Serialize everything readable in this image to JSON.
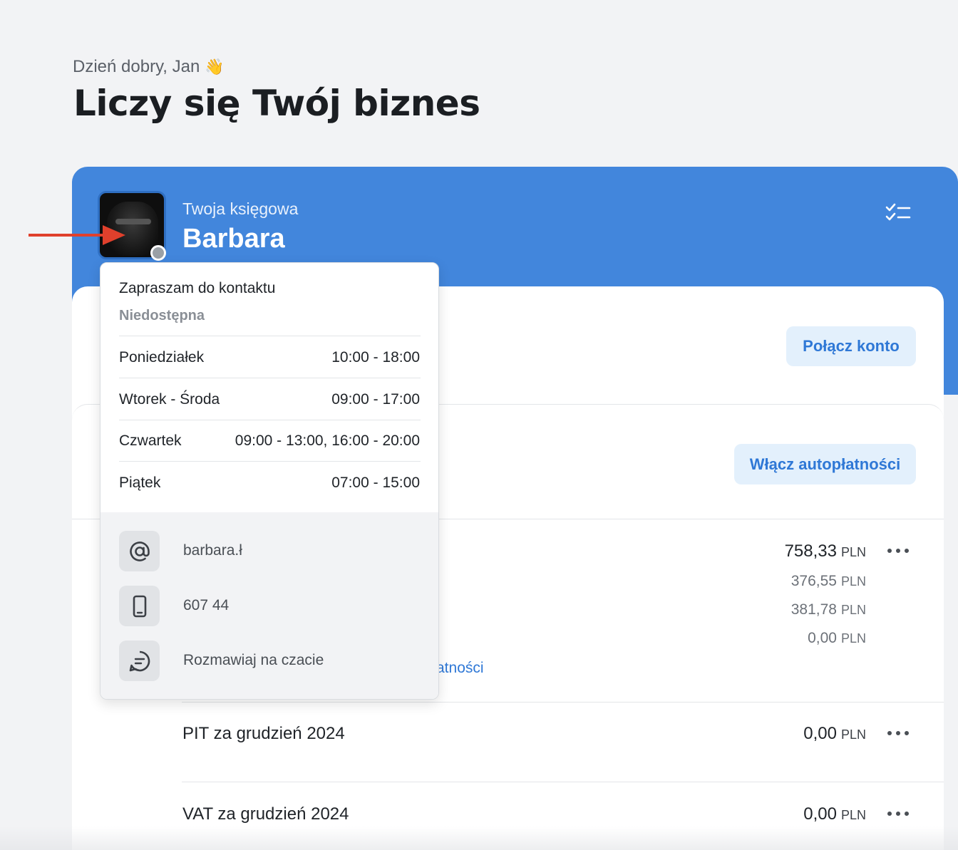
{
  "header": {
    "greeting": "Dzień dobry, Jan",
    "greeting_emoji": "👋",
    "title": "Liczy się Twój biznes"
  },
  "accountant": {
    "role": "Twoja księgowa",
    "name": "Barbara",
    "status_color": "#9aa0a6"
  },
  "colors": {
    "brand_blue": "#4286dc",
    "button_bg": "#e3f0fc",
    "button_text": "#2f78d6",
    "arrow": "#e0402c"
  },
  "cards": {
    "connect_button": "Połącz konto",
    "autopay_button": "Włącz autopłatności",
    "link_partial": "atności"
  },
  "payments": {
    "main": {
      "amount": "758,33",
      "currency": "PLN",
      "sub_amounts": [
        {
          "amount": "376,55",
          "currency": "PLN"
        },
        {
          "amount": "381,78",
          "currency": "PLN"
        },
        {
          "amount": "0,00",
          "currency": "PLN"
        }
      ]
    },
    "rows": [
      {
        "label": "PIT za grudzień 2024",
        "amount": "0,00",
        "currency": "PLN"
      },
      {
        "label": "VAT za grudzień 2024",
        "amount": "0,00",
        "currency": "PLN"
      }
    ]
  },
  "popover": {
    "title": "Zapraszam do kontaktu",
    "status": "Niedostępna",
    "schedule": [
      {
        "day": "Poniedziałek",
        "hours": "10:00 - 18:00"
      },
      {
        "day": "Wtorek - Środa",
        "hours": "09:00 - 17:00"
      },
      {
        "day": "Czwartek",
        "hours": "09:00 - 13:00, 16:00 - 20:00"
      },
      {
        "day": "Piątek",
        "hours": "07:00 - 15:00"
      }
    ],
    "contacts": {
      "email": "barbara.ł",
      "phone": "607 44",
      "chat": "Rozmawiaj na czacie"
    }
  }
}
